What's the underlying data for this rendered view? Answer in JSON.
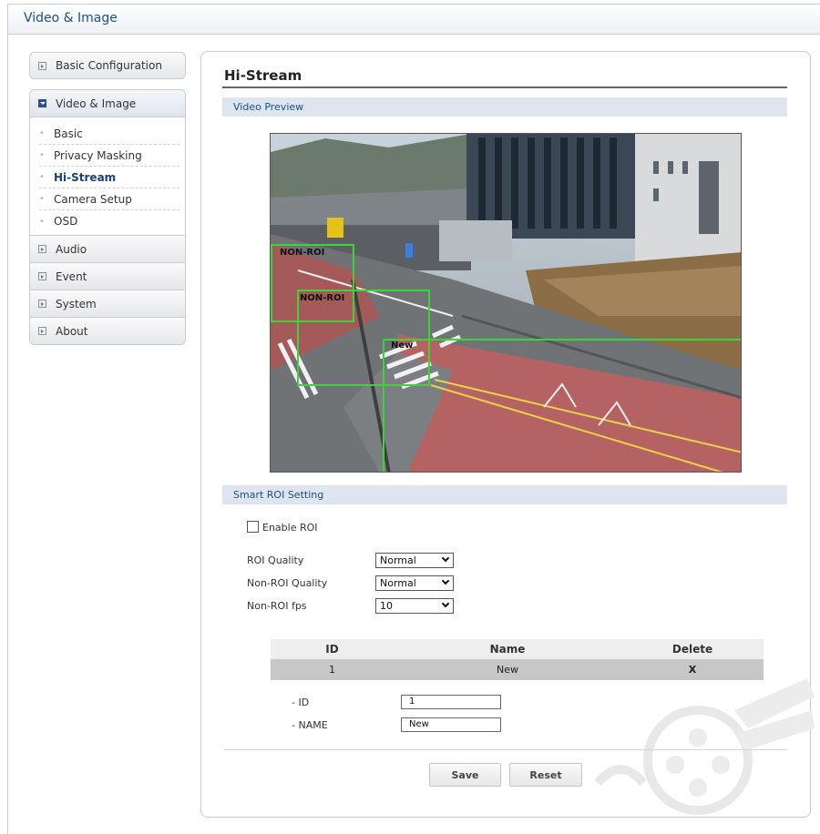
{
  "app": {
    "title": "Video & Image"
  },
  "sidebar": {
    "basic_configuration": "Basic Configuration",
    "video_image": "Video & Image",
    "sub_items": [
      "Basic",
      "Privacy Masking",
      "Hi-Stream",
      "Camera Setup",
      "OSD"
    ],
    "active_sub_item": "Hi-Stream",
    "more": [
      "Audio",
      "Event",
      "System",
      "About"
    ]
  },
  "page": {
    "title": "Hi-Stream",
    "video_preview": "Video Preview",
    "roi_labels": [
      "NON-ROI",
      "New"
    ],
    "smart_roi_setting": "Smart ROI Setting"
  },
  "form": {
    "enable_roi": "Enable ROI",
    "enable_roi_checked": false,
    "roi_quality_label": "ROI Quality",
    "roi_quality_value": "Normal",
    "non_roi_quality_label": "Non-ROI Quality",
    "non_roi_quality_value": "Normal",
    "non_roi_fps_label": "Non-ROI fps",
    "non_roi_fps_value": "10"
  },
  "roi_table": {
    "headers": [
      "ID",
      "Name",
      "Delete"
    ],
    "rows": [
      {
        "id": "1",
        "name": "New",
        "delete": "X"
      }
    ]
  },
  "roi_detail": {
    "id_label": "- ID",
    "id_value": "1",
    "name_label": "- NAME",
    "name_value": "New"
  },
  "buttons": {
    "save": "Save",
    "reset": "Reset"
  },
  "colors": {
    "accent": "#1b4f86",
    "roi_box": "#3fd23a",
    "section_bg": "#dfe5ef"
  }
}
